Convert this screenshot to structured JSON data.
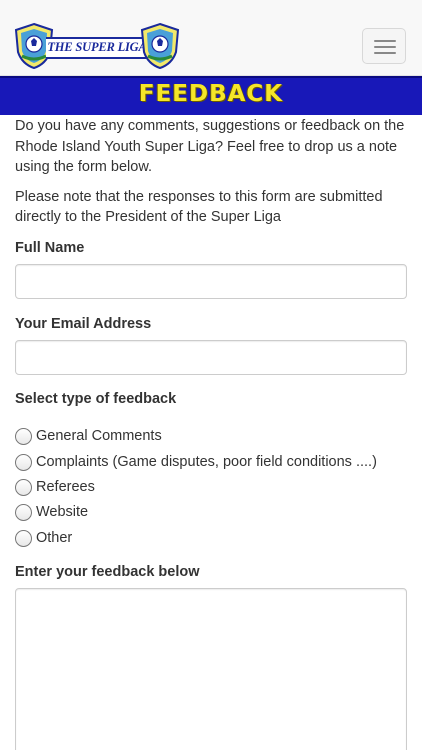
{
  "header": {
    "logo_text": "THE SUPER LIGA",
    "menu_icon": "hamburger-menu-icon",
    "colors": {
      "brand_blue": "#1818b8",
      "banner_text": "#f5e629"
    }
  },
  "banner": {
    "title": "FEEDBACK"
  },
  "intro": {
    "paragraph_1": "Do you have any comments, suggestions or feedback on the Rhode Island Youth Super Liga? Feel free to drop us a note using the form below.",
    "paragraph_2": "Please note that the responses to this form are submitted directly to the President of the Super Liga"
  },
  "form": {
    "full_name": {
      "label": "Full Name",
      "value": "",
      "placeholder": ""
    },
    "email": {
      "label": "Your Email Address",
      "value": "",
      "placeholder": ""
    },
    "feedback_type": {
      "label": "Select type of feedback",
      "options": [
        "General Comments",
        "Complaints (Game disputes, poor field conditions ....)",
        "Referees",
        "Website",
        "Other"
      ]
    },
    "feedback": {
      "label": "Enter your feedback below",
      "value": "",
      "placeholder": ""
    }
  }
}
